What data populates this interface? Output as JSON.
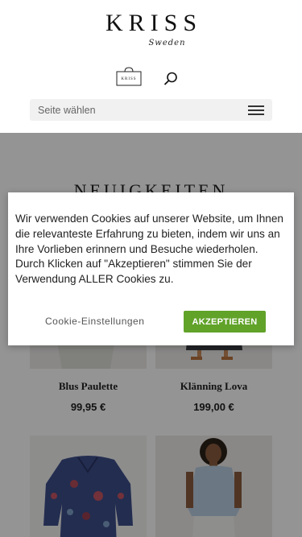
{
  "header": {
    "logo_text": "KRISS",
    "logo_subtext": "Sweden",
    "cart_logo_text": "KRISS"
  },
  "nav": {
    "select_label": "Seite wählen"
  },
  "main": {
    "section_title": "NEUIGKEITEN",
    "products": [
      {
        "name": "Blus Paulette",
        "price": "99,95 €"
      },
      {
        "name": "Klänning Lova",
        "price": "199,00 €"
      },
      {
        "name": "",
        "price": ""
      },
      {
        "name": "",
        "price": ""
      }
    ]
  },
  "cookie_banner": {
    "text": "Wir verwenden Cookies auf unserer Website, um Ihnen die relevanteste Erfahrung zu bieten, indem wir uns an Ihre Vorlieben erinnern und Besuche wiederholen. Durch Klicken auf \"Akzeptieren\" stimmen Sie der Verwendung ALLER Cookies zu.",
    "settings_label": "Cookie-Einstellungen",
    "accept_label": "AKZEPTIEREN"
  },
  "colors": {
    "accept_button": "#61a229",
    "overlay": "rgba(0,0,0,0.42)"
  }
}
